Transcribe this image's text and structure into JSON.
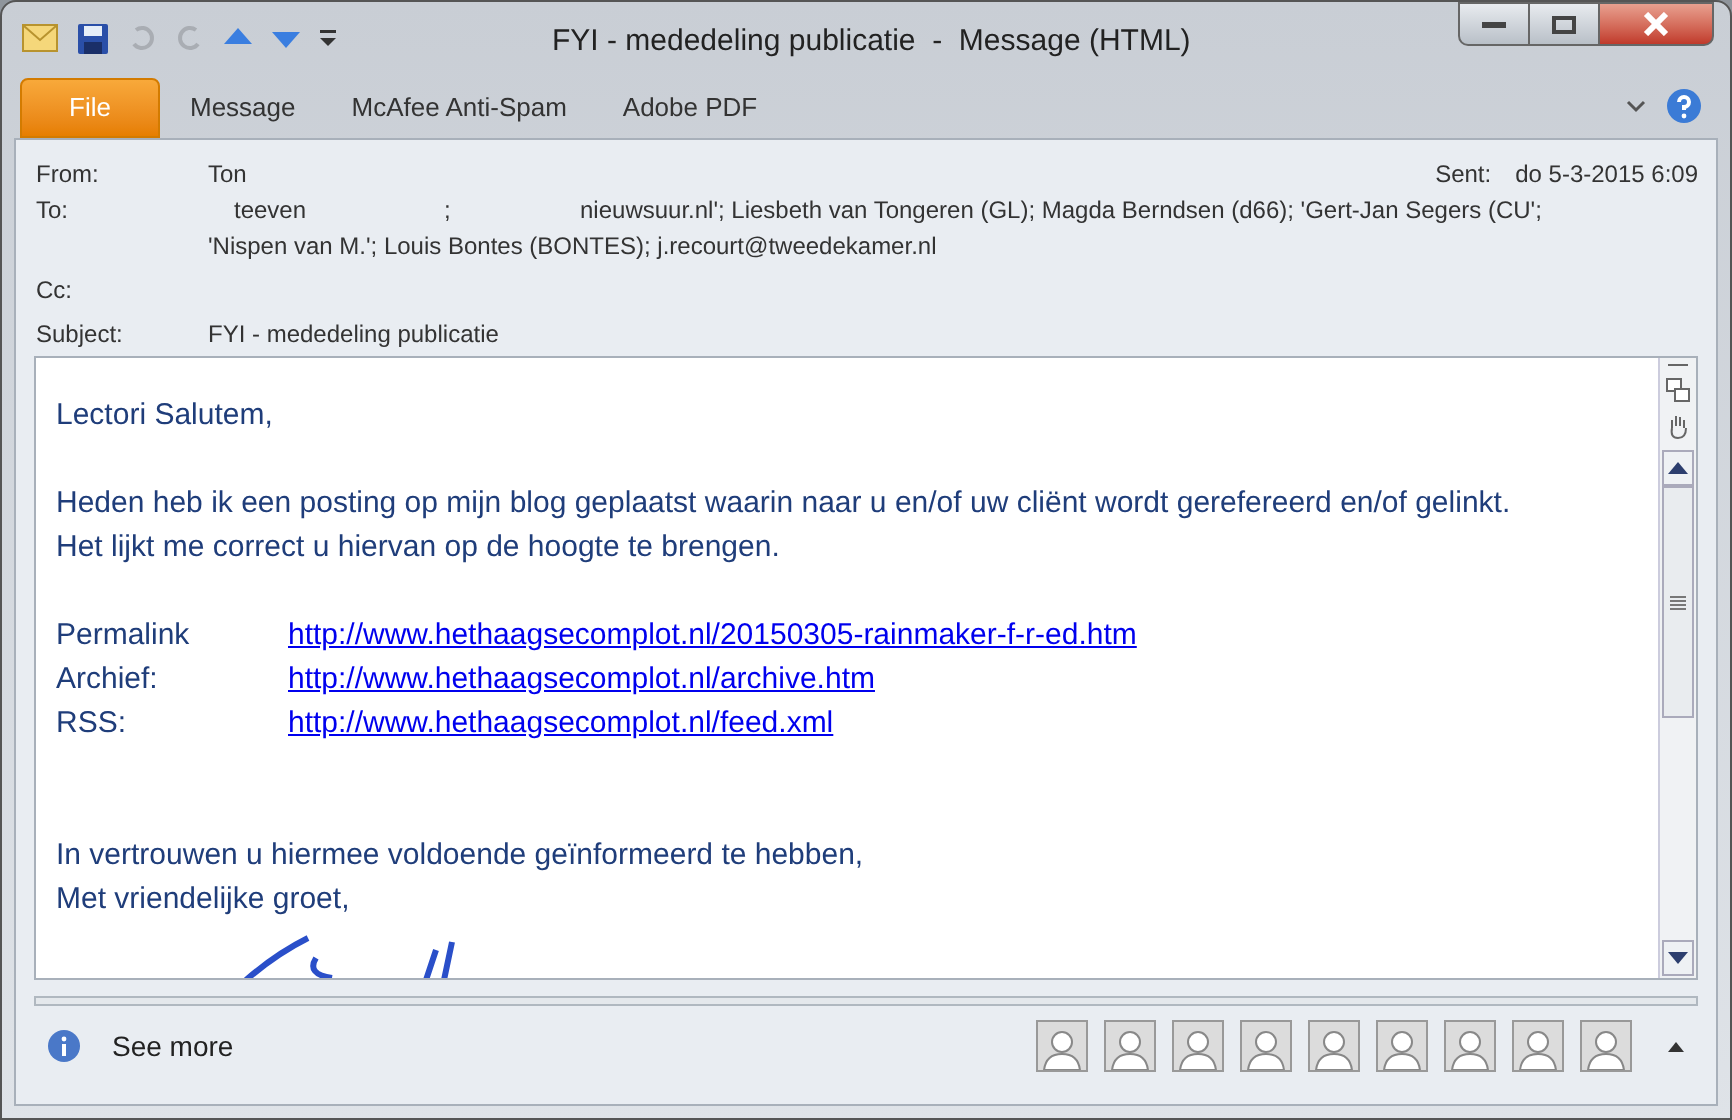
{
  "window": {
    "title": "FYI - mededeling publicatie  -  Message (HTML)"
  },
  "ribbon_tabs": [
    {
      "label": "File",
      "kind": "file",
      "selected": false
    },
    {
      "label": "Message",
      "kind": "tab",
      "selected": false
    },
    {
      "label": "McAfee Anti-Spam",
      "kind": "tab",
      "selected": false
    },
    {
      "label": "Adobe PDF",
      "kind": "tab",
      "selected": false
    }
  ],
  "header": {
    "from_label": "From:",
    "from": "Ton",
    "sent_label": "Sent:",
    "sent": "do 5-3-2015 6:09",
    "to_label": "To:",
    "to_line1": [
      "teeven",
      ";",
      "nieuwsuur.nl'; Liesbeth van Tongeren (GL); Magda Berndsen (d66); 'Gert-Jan Segers (CU';"
    ],
    "to_line2": "'Nispen van M.'; Louis Bontes (BONTES); j.recourt@tweedekamer.nl",
    "cc_label": "Cc:",
    "subject_label": "Subject:",
    "subject": "FYI - mededeling publicatie"
  },
  "body": [
    {
      "kind": "para",
      "text": "Lectori Salutem,"
    },
    {
      "kind": "gap"
    },
    {
      "kind": "para",
      "text": "Heden heb ik een posting op mijn blog geplaatst waarin naar u en/of uw cliënt wordt gerefereerd en/of gelinkt."
    },
    {
      "kind": "para",
      "text": "Het lijkt me correct u hiervan op de hoogte te brengen."
    },
    {
      "kind": "gap"
    },
    {
      "kind": "link",
      "label": "Permalink",
      "url": "http://www.hethaagsecomplot.nl/20150305-rainmaker-f-r-ed.htm"
    },
    {
      "kind": "link",
      "label": "Archief:",
      "url": "http://www.hethaagsecomplot.nl/archive.htm"
    },
    {
      "kind": "link",
      "label": "RSS:",
      "url": "http://www.hethaagsecomplot.nl/feed.xml"
    },
    {
      "kind": "gap"
    },
    {
      "kind": "gap"
    },
    {
      "kind": "para",
      "text": "In vertrouwen u hiermee voldoende geïnformeerd te hebben,"
    },
    {
      "kind": "para",
      "text": "Met vriendelijke groet,"
    }
  ],
  "people_pane": {
    "label": "See more",
    "people": [
      {
        "kind": "contact"
      },
      {
        "kind": "contact"
      },
      {
        "kind": "contact"
      },
      {
        "kind": "contact"
      },
      {
        "kind": "contact"
      },
      {
        "kind": "contact"
      },
      {
        "kind": "contact"
      },
      {
        "kind": "contact"
      },
      {
        "kind": "contact"
      }
    ]
  }
}
